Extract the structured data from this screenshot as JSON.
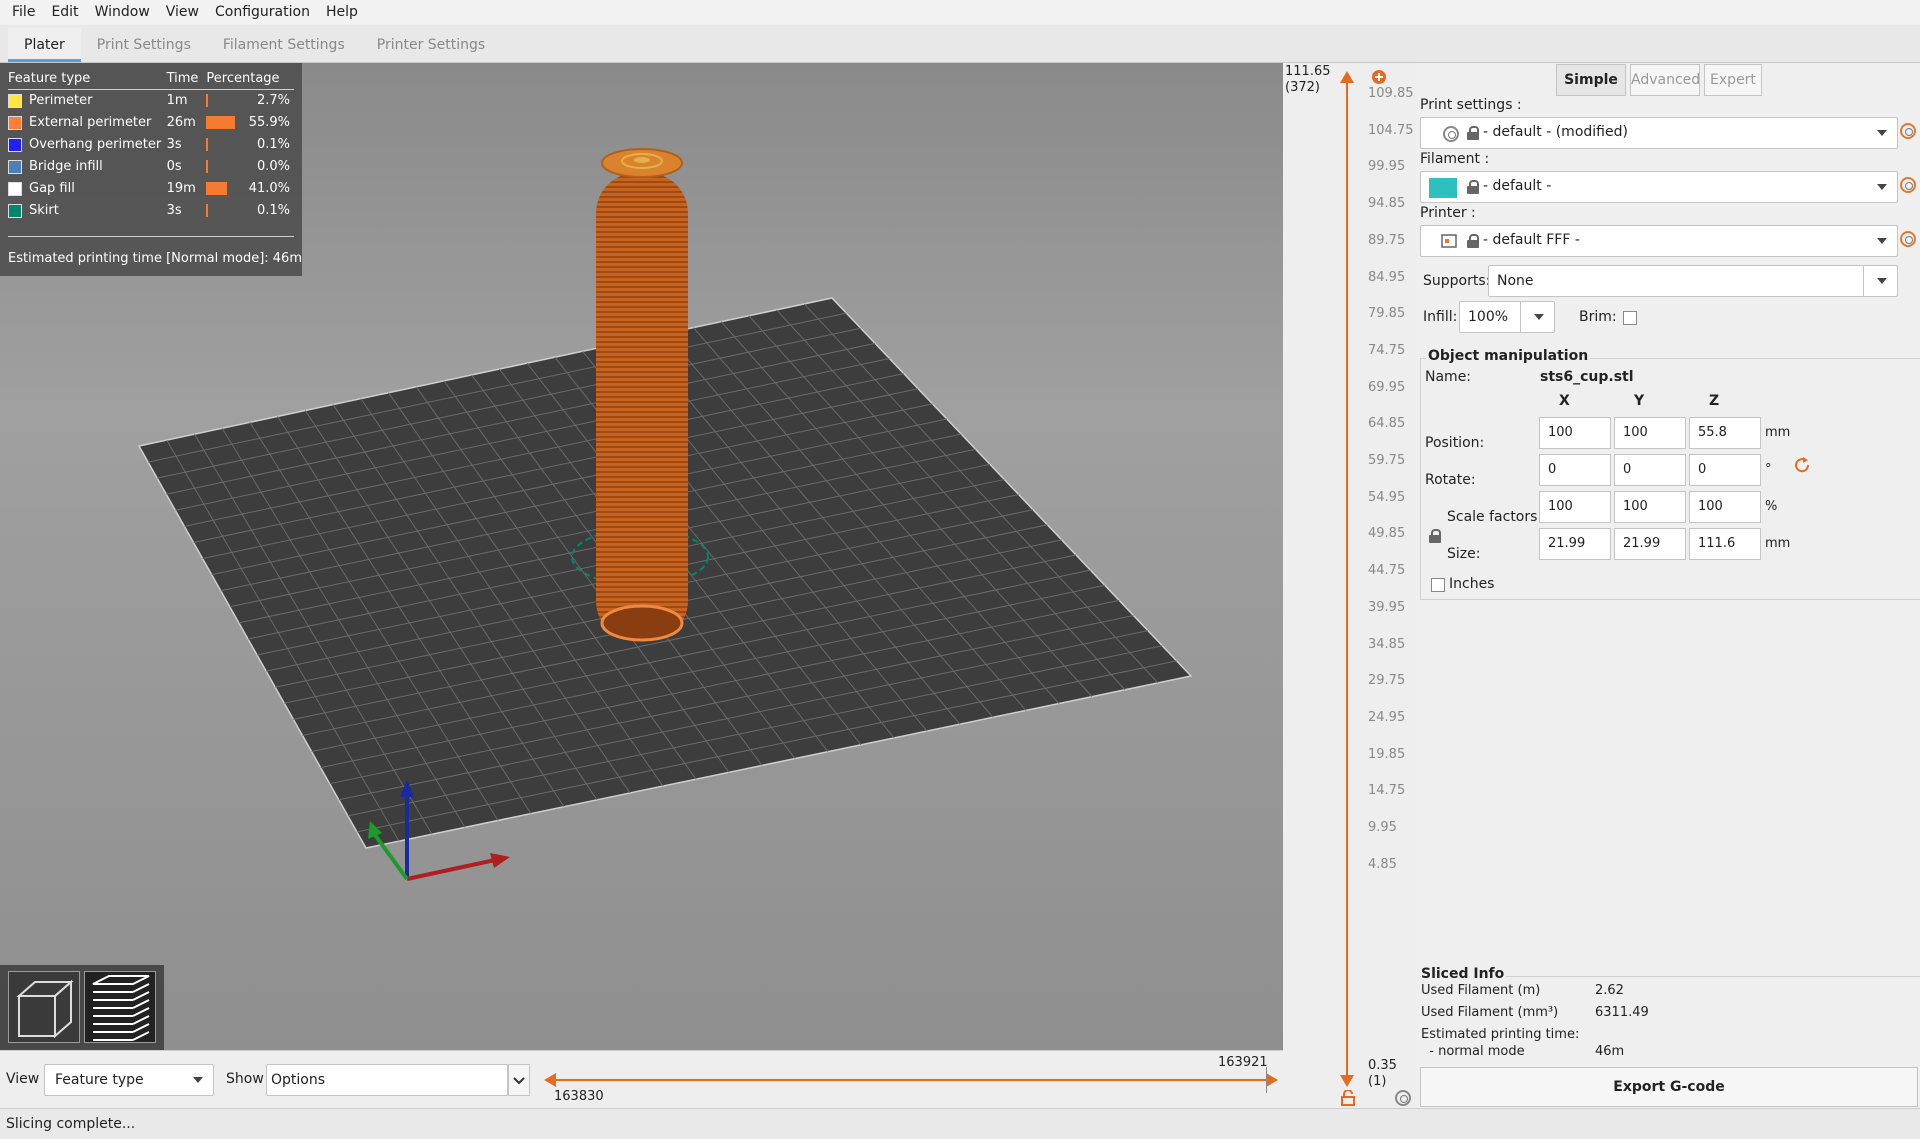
{
  "menu": [
    "File",
    "Edit",
    "Window",
    "View",
    "Configuration",
    "Help"
  ],
  "tabs": [
    {
      "label": "Plater",
      "active": true
    },
    {
      "label": "Print Settings",
      "active": false
    },
    {
      "label": "Filament Settings",
      "active": false
    },
    {
      "label": "Printer Settings",
      "active": false
    }
  ],
  "legend": {
    "headers": {
      "feature": "Feature type",
      "time": "Time",
      "percentage": "Percentage"
    },
    "rows": [
      {
        "name": "Perimeter",
        "color": "#ffe640",
        "time": "1m",
        "percent": "2.7%",
        "fraction": 0.027
      },
      {
        "name": "External perimeter",
        "color": "#ff7d38",
        "time": "26m",
        "percent": "55.9%",
        "fraction": 0.559
      },
      {
        "name": "Overhang perimeter",
        "color": "#1f1fff",
        "time": "3s",
        "percent": "0.1%",
        "fraction": 0.001
      },
      {
        "name": "Bridge infill",
        "color": "#4d80ba",
        "time": "0s",
        "percent": "0.0%",
        "fraction": 0.0
      },
      {
        "name": "Gap fill",
        "color": "#ffffff",
        "time": "19m",
        "percent": "41.0%",
        "fraction": 0.41
      },
      {
        "name": "Skirt",
        "color": "#00876e",
        "time": "3s",
        "percent": "0.1%",
        "fraction": 0.001
      }
    ],
    "estimate": "Estimated printing time [Normal mode]:  46m"
  },
  "bottom": {
    "view_label": "View",
    "view_value": "Feature type",
    "show_label": "Show",
    "show_value": "Options",
    "slider_start": "163830",
    "slider_end": "163921"
  },
  "vslider": {
    "top_value": "111.65",
    "top_layer": "(372)",
    "bottom_value": "0.35",
    "bottom_layer": "(1)",
    "ticks": [
      "109.85",
      "104.75",
      "99.95",
      "94.85",
      "89.75",
      "84.95",
      "79.85",
      "74.75",
      "69.95",
      "64.85",
      "59.75",
      "54.95",
      "49.85",
      "44.75",
      "39.95",
      "34.85",
      "29.75",
      "24.95",
      "19.85",
      "14.75",
      "9.95",
      "4.85"
    ]
  },
  "panel": {
    "modes": [
      "Simple",
      "Advanced",
      "Expert"
    ],
    "print_settings_label": "Print settings :",
    "print_settings_value": "- default - (modified)",
    "filament_label": "Filament :",
    "filament_value": "- default -",
    "filament_color": "#2ebfbf",
    "printer_label": "Printer :",
    "printer_value": "- default FFF -",
    "supports_label": "Supports:",
    "supports_value": "None",
    "infill_label": "Infill:",
    "infill_value": "100%",
    "brim_label": "Brim:",
    "object": {
      "title": "Object manipulation",
      "name_label": "Name:",
      "name_value": "sts6_cup.stl",
      "axes": [
        "X",
        "Y",
        "Z"
      ],
      "position_label": "Position:",
      "position": [
        "100",
        "100",
        "55.8"
      ],
      "position_unit": "mm",
      "rotate_label": "Rotate:",
      "rotate": [
        "0",
        "0",
        "0"
      ],
      "rotate_unit": "°",
      "scale_label": "Scale factors:",
      "scale": [
        "100",
        "100",
        "100"
      ],
      "scale_unit": "%",
      "size_label": "Size:",
      "size": [
        "21.99",
        "21.99",
        "111.6"
      ],
      "size_unit": "mm",
      "inches_label": "Inches"
    },
    "sliced": {
      "title": "Sliced Info",
      "rows": [
        {
          "label": "Used Filament (m)",
          "value": "2.62"
        },
        {
          "label": "Used Filament (mm³)",
          "value": "6311.49"
        },
        {
          "label": "Estimated printing time:",
          "value": ""
        },
        {
          "label": "  - normal mode",
          "value": "46m"
        }
      ]
    },
    "export_label": "Export G-code"
  },
  "status": "Slicing complete..."
}
